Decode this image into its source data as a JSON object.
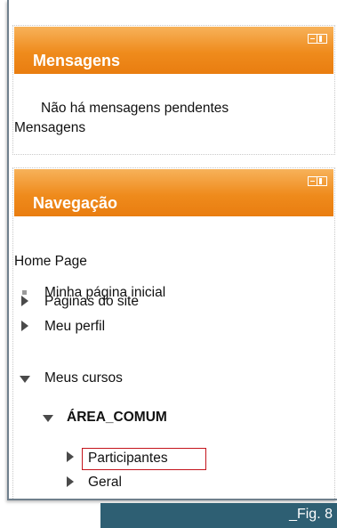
{
  "mensagens_block": {
    "title": "Mensagens",
    "no_pending": "Não há mensagens pendentes",
    "link": "Mensagens"
  },
  "navegacao_block": {
    "title": "Navegação",
    "home": "Home Page",
    "items": [
      {
        "label": "Minha página inicial",
        "icon": "bullet-square-icon"
      },
      {
        "label": "Páginas do site",
        "icon": "triangle-right-icon"
      },
      {
        "label": "Meu perfil",
        "icon": "triangle-right-icon"
      },
      {
        "label": "Meus cursos",
        "icon": "triangle-down-icon"
      }
    ],
    "course": {
      "label": "ÁREA_COMUM",
      "children": [
        {
          "label": "Participantes",
          "highlighted": true
        },
        {
          "label": "Geral"
        }
      ]
    }
  },
  "caption": "_Fig. 8",
  "colors": {
    "header_orange": "#ef8b1c",
    "caption_bar": "#2e5f73",
    "highlight": "#c4141c"
  }
}
